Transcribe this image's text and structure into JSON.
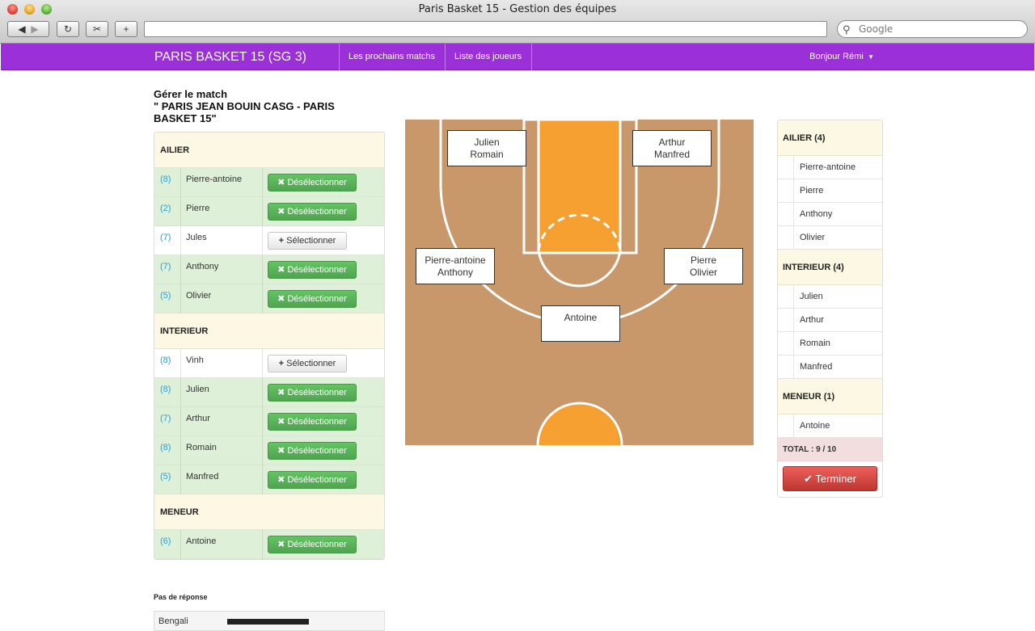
{
  "window": {
    "title": "Paris Basket 15 - Gestion des équipes",
    "search_placeholder": "Google"
  },
  "nav": {
    "brand": "PARIS BASKET 15 (SG 3)",
    "links": [
      "Les prochains matchs",
      "Liste des joueurs"
    ],
    "user": "Bonjour Rémi"
  },
  "heading": {
    "line1": "Gérer le match",
    "line2": "\" PARIS JEAN BOUIN CASG - PARIS BASKET 15\""
  },
  "buttons": {
    "deselect": "Désélectionner",
    "select": "Sélectionner",
    "finish": "Terminer"
  },
  "roster": [
    {
      "group": "AILIER",
      "players": [
        {
          "num": "(8)",
          "name": "Pierre-antoine",
          "selected": true
        },
        {
          "num": "(2)",
          "name": "Pierre",
          "selected": true
        },
        {
          "num": "(7)",
          "name": "Jules",
          "selected": false
        },
        {
          "num": "(7)",
          "name": "Anthony",
          "selected": true
        },
        {
          "num": "(5)",
          "name": "Olivier",
          "selected": true
        }
      ]
    },
    {
      "group": "INTERIEUR",
      "players": [
        {
          "num": "(8)",
          "name": "Vinh",
          "selected": false
        },
        {
          "num": "(8)",
          "name": "Julien",
          "selected": true
        },
        {
          "num": "(7)",
          "name": "Arthur",
          "selected": true
        },
        {
          "num": "(8)",
          "name": "Romain",
          "selected": true
        },
        {
          "num": "(5)",
          "name": "Manfred",
          "selected": true
        }
      ]
    },
    {
      "group": "MENEUR",
      "players": [
        {
          "num": "(6)",
          "name": "Antoine",
          "selected": true
        }
      ]
    }
  ],
  "no_response": {
    "title": "Pas de réponse",
    "rows": [
      {
        "name": "Bengali"
      }
    ]
  },
  "court": {
    "positions": [
      {
        "line1": "Julien",
        "line2": "Romain"
      },
      {
        "line1": "Arthur",
        "line2": "Manfred"
      },
      {
        "line1": "Pierre-antoine",
        "line2": "Anthony"
      },
      {
        "line1": "Pierre",
        "line2": "Olivier"
      },
      {
        "line1": "Antoine",
        "line2": ""
      }
    ],
    "colors": {
      "floor": "#c8986a",
      "paint": "#f5a030",
      "lines": "#ffffff"
    }
  },
  "summary": {
    "groups": [
      {
        "title": "AILIER (4)",
        "names": [
          "Pierre-antoine",
          "Pierre",
          "Anthony",
          "Olivier"
        ]
      },
      {
        "title": "INTERIEUR (4)",
        "names": [
          "Julien",
          "Arthur",
          "Romain",
          "Manfred"
        ]
      },
      {
        "title": "MENEUR (1)",
        "names": [
          "Antoine"
        ]
      }
    ],
    "total": "TOTAL : 9 / 10"
  },
  "colors": {
    "brand": "#9b30d9",
    "success": "#5bb75b",
    "danger": "#da4f49"
  }
}
